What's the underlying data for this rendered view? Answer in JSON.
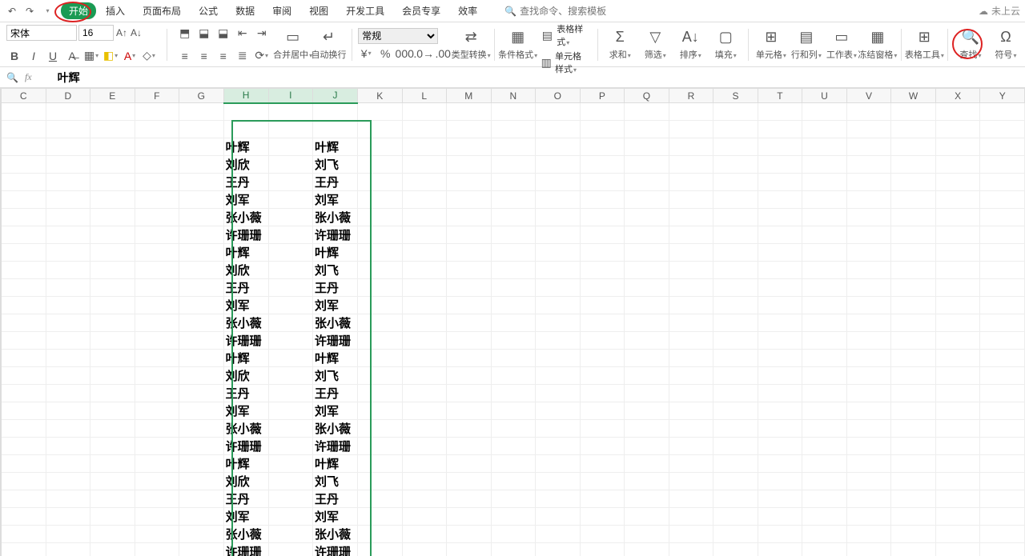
{
  "menu": {
    "tabs": [
      "开始",
      "插入",
      "页面布局",
      "公式",
      "数据",
      "审阅",
      "视图",
      "开发工具",
      "会员专享",
      "效率"
    ],
    "active_index": 0,
    "search_placeholder": "查找命令、搜索模板",
    "cloud_status": "未上云"
  },
  "ribbon": {
    "font_name": "宋体",
    "font_size": "16",
    "numfmt": "常规",
    "groups": {
      "merge": "合并居中",
      "wrap": "自动换行",
      "type_convert": "类型转换",
      "cond_fmt": "条件格式",
      "table_style": "表格样式",
      "cell_style": "单元格样式",
      "sum": "求和",
      "filter": "筛选",
      "sort": "排序",
      "fill": "填充",
      "cell": "单元格",
      "rowcol": "行和列",
      "worksheet": "工作表",
      "freeze": "冻结窗格",
      "tools": "表格工具",
      "find": "查找",
      "symbol": "符号"
    }
  },
  "formula_bar": {
    "value": "叶辉"
  },
  "columns": [
    "C",
    "D",
    "E",
    "F",
    "G",
    "H",
    "I",
    "J",
    "K",
    "L",
    "M",
    "N",
    "O",
    "P",
    "Q",
    "R",
    "S",
    "T",
    "U",
    "V",
    "W",
    "X",
    "Y"
  ],
  "selected_cols": [
    "H",
    "I",
    "J"
  ],
  "data_start_row_index": 2,
  "table": {
    "H": [
      "叶辉",
      "刘欣",
      "王丹",
      "刘军",
      "张小薇",
      "许珊珊",
      "叶辉",
      "刘欣",
      "王丹",
      "刘军",
      "张小薇",
      "许珊珊",
      "叶辉",
      "刘欣",
      "王丹",
      "刘军",
      "张小薇",
      "许珊珊",
      "叶辉",
      "刘欣",
      "王丹",
      "刘军",
      "张小薇",
      "许珊珊"
    ],
    "J": [
      "叶辉",
      "刘飞",
      "王丹",
      "刘军",
      "张小薇",
      "许珊珊",
      "叶辉",
      "刘飞",
      "王丹",
      "刘军",
      "张小薇",
      "许珊珊",
      "叶辉",
      "刘飞",
      "王丹",
      "刘军",
      "张小薇",
      "许珊珊",
      "叶辉",
      "刘飞",
      "王丹",
      "刘军",
      "张小薇",
      "许珊珊"
    ]
  }
}
